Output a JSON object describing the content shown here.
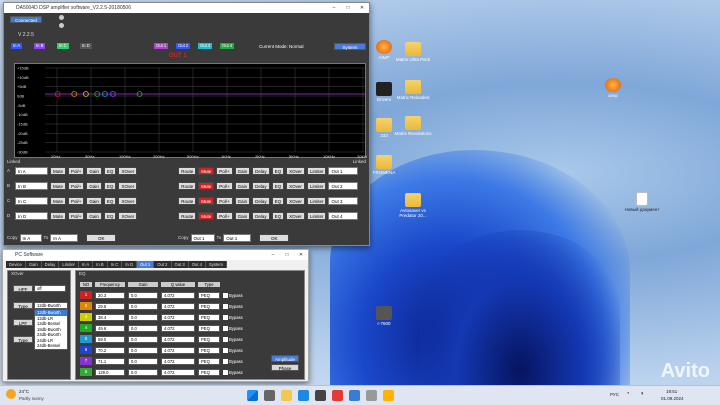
{
  "dsp": {
    "title": "DA5004D DSP amplifier software_V2.2.5-20180506",
    "connect": "Connected",
    "version": "V 2.2.5",
    "channels": [
      {
        "label": "In A",
        "color": "#3355ff"
      },
      {
        "label": "In B",
        "color": "#8844ee"
      },
      {
        "label": "In C",
        "color": "#33cc66"
      },
      {
        "label": "In D",
        "color": "#555555"
      },
      {
        "label": "Out 1",
        "color": "#aa44cc"
      },
      {
        "label": "Out 2",
        "color": "#3355ff"
      },
      {
        "label": "Out 3",
        "color": "#22bbcc"
      },
      {
        "label": "Out 4",
        "color": "#22aa44"
      }
    ],
    "mode_label": "Current Mode:",
    "mode_value": "Normal",
    "system": "System",
    "graph_title": "OUT 1",
    "ylabels": [
      "+15dB",
      "+10dB",
      "+5dB",
      "0dB",
      "-5dB",
      "-10dB",
      "-15dB",
      "-20dB",
      "-25dB",
      "-30dB"
    ],
    "xlabels": [
      "20Hz",
      "50Hz",
      "100Hz",
      "200Hz",
      "500Hz",
      "1KHz",
      "2KHz",
      "5KHz",
      "10KHz",
      "20KHz"
    ],
    "eq_points": [
      "1",
      "2",
      "3",
      "4",
      "5",
      "6",
      "7",
      "8"
    ],
    "linked_left": "Linked",
    "linked_right": "Linked",
    "inputs": [
      {
        "ch": "A",
        "name": "In A",
        "out": "Out 1"
      },
      {
        "ch": "B",
        "name": "In B",
        "out": "Out 2"
      },
      {
        "ch": "C",
        "name": "In C",
        "out": "Out 3"
      },
      {
        "ch": "D",
        "name": "In D",
        "out": "Out 4"
      }
    ],
    "in_buttons": [
      "Mute",
      "Pol/+",
      "Gain",
      "EQ",
      "XOver"
    ],
    "out_buttons": [
      "Route",
      "Mute",
      "Pol/+",
      "Gain",
      "Delay",
      "EQ",
      "XOver",
      "Limiter"
    ],
    "copy_label": "Copy",
    "to_label": "To",
    "copy_in_from": "In A",
    "copy_in_to": "In A",
    "copy_out_from": "Out 1",
    "copy_out_to": "Out 1",
    "ok": "OK"
  },
  "pc": {
    "title": "PC Software",
    "tabs": [
      "Device",
      "Gain",
      "Delay",
      "Limiter",
      "In A",
      "In B",
      "In C",
      "In D",
      "Out 1",
      "Out 2",
      "Out 3",
      "Out 4",
      "System"
    ],
    "active_tab": "Out 1",
    "xover_label": "XOver",
    "hpf": "HPF",
    "hpf_value": "off",
    "type": "Type",
    "type_value": "12db-Bworth",
    "lpf": "LPF",
    "type_options": [
      "12db-Bworth",
      "12db-LR",
      "12db-Bessel",
      "18db-Bworth",
      "24db-Bworth",
      "24db-LR",
      "24db-Bessel"
    ],
    "eq_label": "EQ",
    "eq_headers": [
      "NO",
      "Frequency",
      "Gain",
      "Q value",
      "Type"
    ],
    "eq_rows": [
      {
        "no": "1",
        "freq": "20.3",
        "gain": "0.0",
        "q": "4.072",
        "type": "PEQ",
        "color": "#cc2222"
      },
      {
        "no": "2",
        "freq": "29.5",
        "gain": "0.0",
        "q": "4.072",
        "type": "PEQ",
        "color": "#dd8800"
      },
      {
        "no": "3",
        "freq": "38.4",
        "gain": "0.0",
        "q": "4.072",
        "type": "PEQ",
        "color": "#cccc00"
      },
      {
        "no": "4",
        "freq": "49.6",
        "gain": "0.0",
        "q": "4.072",
        "type": "PEQ",
        "color": "#22aa22"
      },
      {
        "no": "5",
        "freq": "59.0",
        "gain": "0.0",
        "q": "4.072",
        "type": "PEQ",
        "color": "#2299cc"
      },
      {
        "no": "6",
        "freq": "70.2",
        "gain": "0.0",
        "q": "4.072",
        "type": "PEQ",
        "color": "#2244cc"
      },
      {
        "no": "7",
        "freq": "71.1",
        "gain": "0.0",
        "q": "4.072",
        "type": "PEQ",
        "color": "#8833cc"
      },
      {
        "no": "8",
        "freq": "129.0",
        "gain": "0.0",
        "q": "4.072",
        "type": "PEQ",
        "color": "#33aa33"
      }
    ],
    "bypass": "Bypass",
    "amplitude": "Amplitude",
    "phase": "Phase"
  },
  "desktop": {
    "icons": [
      {
        "label": "AIMP",
        "type": "app1"
      },
      {
        "label": "Matrix Ultra Pack",
        "type": "folder"
      },
      {
        "label": "Drivers",
        "type": "folder"
      },
      {
        "label": "Matrix Reloaded",
        "type": "folder"
      },
      {
        "label": "333",
        "type": "folder"
      },
      {
        "label": "Matrix Revolutions",
        "type": "folder"
      },
      {
        "label": "FROMENA",
        "type": "folder"
      },
      {
        "label": "Avtosaver vs Predator 20...",
        "type": "folder"
      },
      {
        "label": "r-7600",
        "type": "folder"
      },
      {
        "label": "aimp",
        "type": "app1"
      },
      {
        "label": "Новый документ",
        "type": "file"
      }
    ]
  },
  "taskbar": {
    "temp": "24°C",
    "weather": "Partly sunny",
    "lang": "РУС",
    "time": "19:51",
    "date": "01.09.2024"
  },
  "watermark": "Avito"
}
